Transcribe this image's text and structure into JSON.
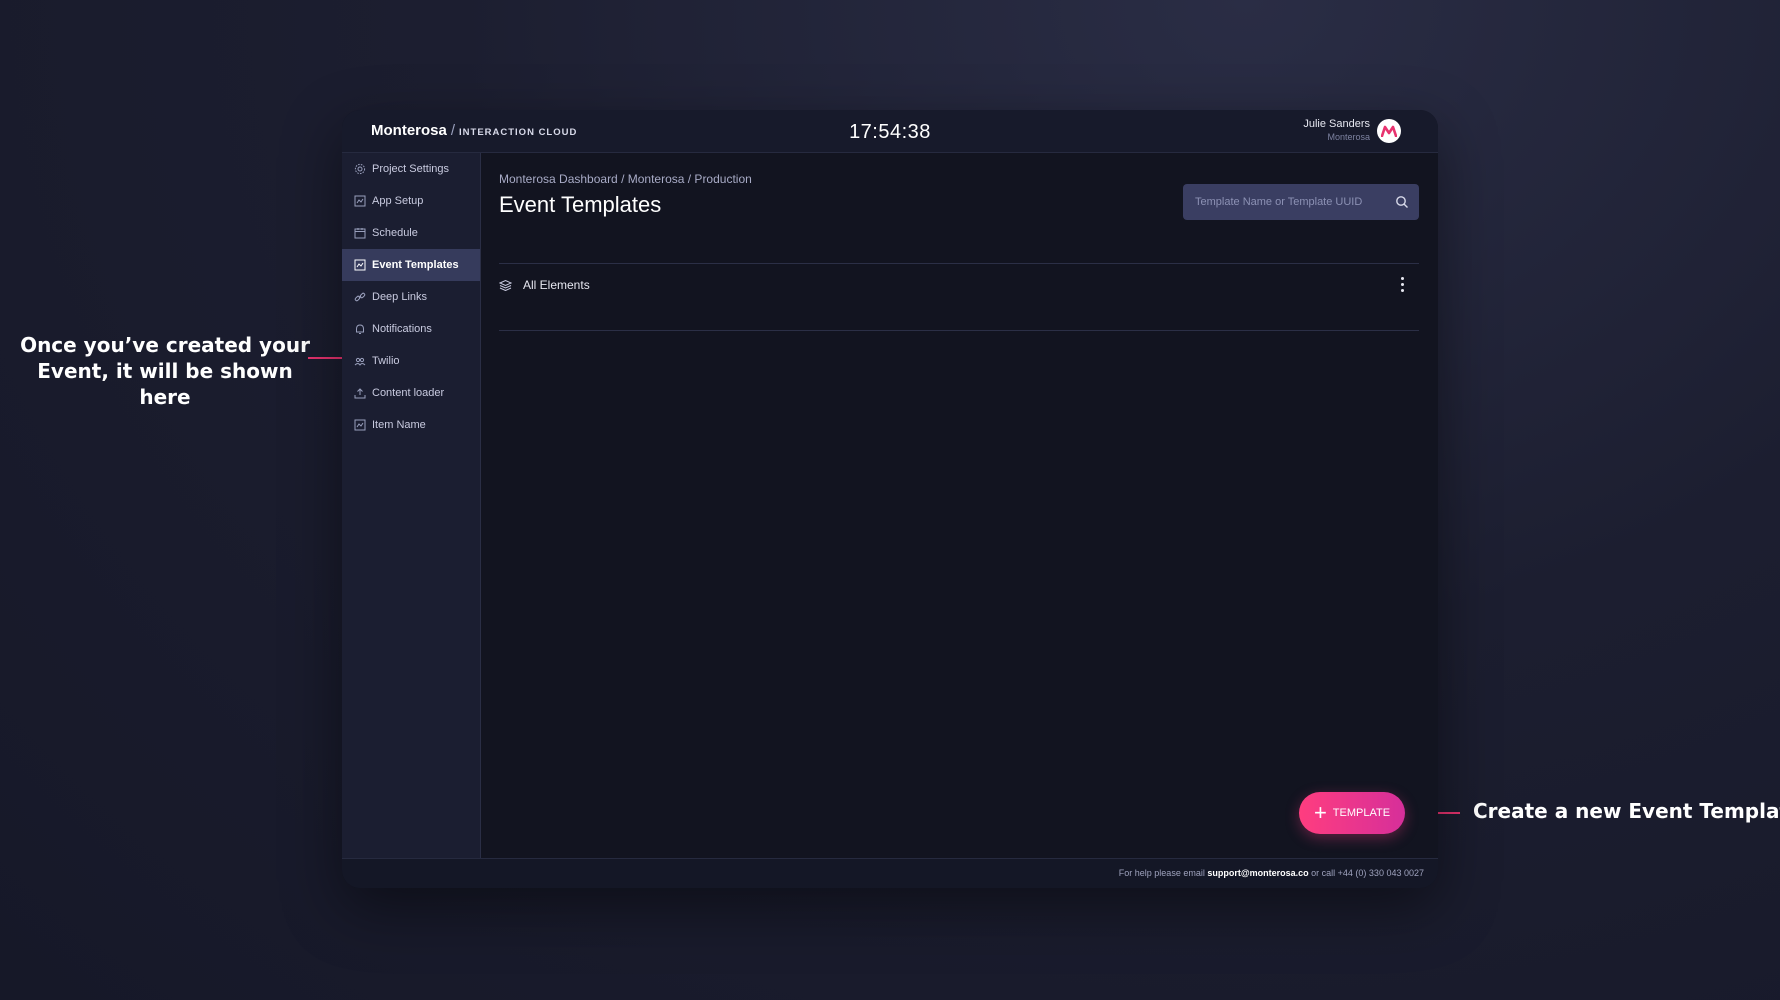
{
  "annotations": {
    "left": "Once you’ve created your Event, it will be shown here",
    "right": "Create a new Event Template"
  },
  "header": {
    "brand": "Monterosa",
    "brand_sub": "INTERACTION CLOUD",
    "clock": "17:54:38",
    "user_name": "Julie Sanders",
    "user_org": "Monterosa"
  },
  "sidebar": {
    "items": [
      {
        "label": "Project Settings",
        "icon": "gear-icon",
        "active": false
      },
      {
        "label": "App Setup",
        "icon": "app-icon",
        "active": false
      },
      {
        "label": "Schedule",
        "icon": "calendar-icon",
        "active": false
      },
      {
        "label": "Event Templates",
        "icon": "template-icon",
        "active": true
      },
      {
        "label": "Deep Links",
        "icon": "link-icon",
        "active": false
      },
      {
        "label": "Notifications",
        "icon": "bell-icon",
        "active": false
      },
      {
        "label": "Twilio",
        "icon": "twilio-icon",
        "active": false
      },
      {
        "label": "Content loader",
        "icon": "upload-icon",
        "active": false
      },
      {
        "label": "Item Name",
        "icon": "app-icon",
        "active": false
      }
    ]
  },
  "main": {
    "breadcrumb": "Monterosa Dashboard / Monterosa / Production",
    "title": "Event Templates",
    "search_placeholder": "Template Name or Template UUID",
    "elements_label": "All Elements",
    "new_button_label": "TEMPLATE"
  },
  "footer": {
    "prefix": "For help please email",
    "email": "support@monterosa.co",
    "suffix": "or call +44 (0) 330 043 0027"
  },
  "colors": {
    "accent": "#e8336f",
    "active_sidebar": "#363b5c",
    "background": "#121420"
  }
}
